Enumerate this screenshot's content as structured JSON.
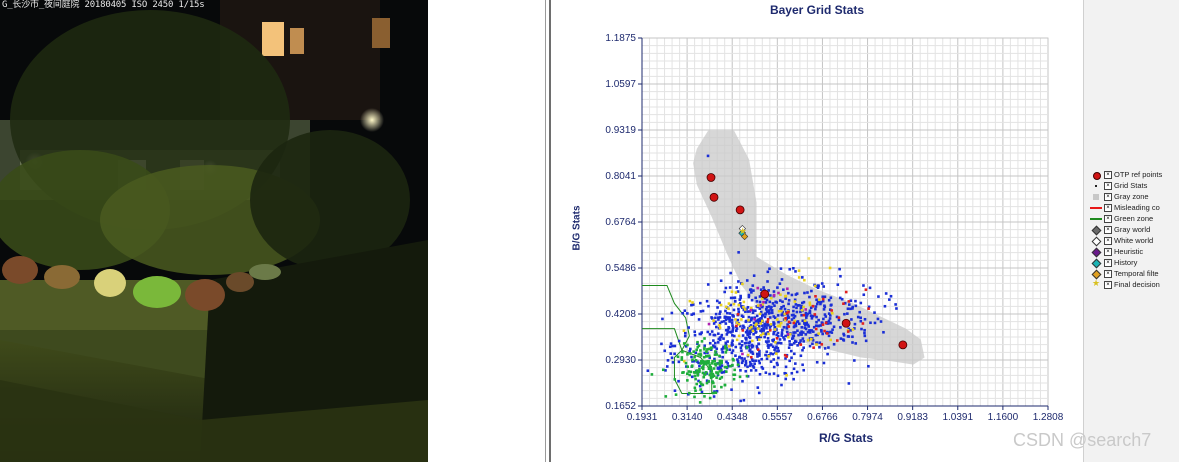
{
  "photo": {
    "caption": "G_长沙市_夜间庭院 20180405 ISO 2450 1/15s"
  },
  "chart_data": {
    "type": "scatter",
    "title": "Bayer Grid Stats",
    "xlabel": "R/G Stats",
    "ylabel": "B/G Stats",
    "xlim": [
      0.1931,
      1.2808
    ],
    "ylim": [
      0.1652,
      1.1875
    ],
    "x_ticks": [
      "0.1931",
      "0.3140",
      "0.4348",
      "0.5557",
      "0.6766",
      "0.7974",
      "0.9183",
      "1.0391",
      "1.1600",
      "1.2808"
    ],
    "y_ticks": [
      "0.1652",
      "0.2930",
      "0.4208",
      "0.5486",
      "0.6764",
      "0.8041",
      "0.9319",
      "1.0597",
      "1.1875"
    ],
    "grid": true,
    "legend_position": "right",
    "gray_zone": [
      [
        0.34,
        0.88
      ],
      [
        0.37,
        0.93
      ],
      [
        0.44,
        0.93
      ],
      [
        0.48,
        0.85
      ],
      [
        0.5,
        0.73
      ],
      [
        0.5,
        0.58
      ],
      [
        0.58,
        0.53
      ],
      [
        0.66,
        0.49
      ],
      [
        0.76,
        0.45
      ],
      [
        0.84,
        0.41
      ],
      [
        0.9,
        0.38
      ],
      [
        0.94,
        0.35
      ],
      [
        0.95,
        0.3
      ],
      [
        0.92,
        0.28
      ],
      [
        0.86,
        0.29
      ],
      [
        0.78,
        0.3
      ],
      [
        0.7,
        0.32
      ],
      [
        0.6,
        0.35
      ],
      [
        0.52,
        0.42
      ],
      [
        0.46,
        0.5
      ],
      [
        0.42,
        0.59
      ],
      [
        0.38,
        0.69
      ],
      [
        0.34,
        0.78
      ],
      [
        0.33,
        0.84
      ]
    ],
    "green_zone": [
      [
        0.1931,
        0.5
      ],
      [
        0.26,
        0.5
      ],
      [
        0.28,
        0.45
      ],
      [
        0.31,
        0.41
      ],
      [
        0.32,
        0.36
      ],
      [
        0.3,
        0.32
      ],
      [
        0.35,
        0.3
      ],
      [
        0.38,
        0.26
      ],
      [
        0.38,
        0.2
      ],
      [
        0.3,
        0.2
      ],
      [
        0.28,
        0.24
      ],
      [
        0.28,
        0.3
      ],
      [
        0.3,
        0.32
      ],
      [
        0.28,
        0.38
      ],
      [
        0.25,
        0.38
      ],
      [
        0.1931,
        0.38
      ]
    ],
    "series": [
      {
        "name": "OTP ref points",
        "marker": "circle-large",
        "color": "#d11414",
        "points": [
          [
            0.378,
            0.8
          ],
          [
            0.386,
            0.745
          ],
          [
            0.456,
            0.71
          ],
          [
            0.522,
            0.476
          ],
          [
            0.74,
            0.395
          ],
          [
            0.892,
            0.335
          ]
        ]
      },
      {
        "name": "Grid Stats",
        "marker": "dot",
        "color": "#1b2fd6",
        "points": []
      },
      {
        "name": "Gray zone",
        "marker": "square",
        "color": "#c8c8c8",
        "points": []
      },
      {
        "name": "Misleading color",
        "marker": "line",
        "color": "#e81818",
        "points": []
      },
      {
        "name": "Green zone",
        "marker": "line",
        "color": "#1e8a1e",
        "points": []
      },
      {
        "name": "Gray world",
        "marker": "diamond",
        "color": "#6a6a6a",
        "points": [
          [
            0.462,
            0.646
          ]
        ]
      },
      {
        "name": "White world",
        "marker": "diamond-open",
        "color": "#666666",
        "points": [
          [
            0.462,
            0.658
          ]
        ]
      },
      {
        "name": "Heuristic",
        "marker": "diamond",
        "color": "#6a1a8c",
        "points": []
      },
      {
        "name": "History",
        "marker": "diamond",
        "color": "#1ab5b5",
        "points": [
          [
            0.461,
            0.645
          ]
        ]
      },
      {
        "name": "Temporal filter",
        "marker": "diamond",
        "color": "#e0a020",
        "points": [
          [
            0.468,
            0.636
          ]
        ]
      },
      {
        "name": "Final decision",
        "marker": "star",
        "color": "#d8c020",
        "points": [
          [
            0.463,
            0.652
          ]
        ]
      }
    ],
    "cloud": {
      "blue_main": {
        "center": [
          0.5,
          0.37
        ],
        "spread": [
          0.11,
          0.07
        ],
        "count": 700
      },
      "blue_wing": {
        "center": [
          0.66,
          0.4
        ],
        "spread": [
          0.09,
          0.04
        ],
        "count": 140
      },
      "green": {
        "center": [
          0.37,
          0.27
        ],
        "spread": [
          0.04,
          0.035
        ],
        "count": 170
      },
      "yellow": {
        "center": [
          0.53,
          0.4
        ],
        "spread": [
          0.1,
          0.06
        ],
        "count": 90
      },
      "red": {
        "center": [
          0.64,
          0.4
        ],
        "spread": [
          0.1,
          0.04
        ],
        "count": 40
      },
      "magenta": {
        "center": [
          0.54,
          0.43
        ],
        "spread": [
          0.07,
          0.05
        ],
        "count": 14
      }
    },
    "colors": {
      "blue": "#1b2fd6",
      "green": "#1fae3c",
      "yellow": "#e8d020",
      "red": "#e02020",
      "magenta": "#b020b0"
    }
  },
  "legend": {
    "items": [
      "OTP ref points",
      "Grid Stats",
      "Gray zone",
      "Misleading co",
      "Green zone",
      "Gray world",
      "White world",
      "Heuristic",
      "History",
      "Temporal filte",
      "Final decision"
    ]
  },
  "watermark": "CSDN @search7"
}
